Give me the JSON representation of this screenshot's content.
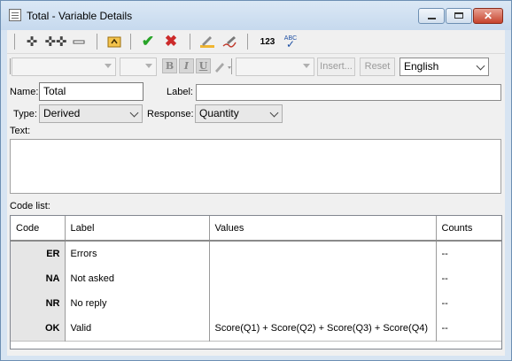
{
  "window": {
    "title": "Total - Variable Details"
  },
  "toolbar2": {
    "insert_label": "Insert...",
    "reset_label": "Reset",
    "language": "English",
    "bold_glyph": "B",
    "italic_glyph": "I",
    "underline_glyph": "U"
  },
  "toolbar1": {
    "number_glyph": "123",
    "spell_glyph": "ABC"
  },
  "form": {
    "name_label": "Name:",
    "name_value": "Total",
    "label_label": "Label:",
    "label_value": "",
    "type_label": "Type:",
    "type_value": "Derived",
    "response_label": "Response:",
    "response_value": "Quantity",
    "text_label": "Text:",
    "codelist_label": "Code list:"
  },
  "codelist": {
    "headers": [
      "Code",
      "Label",
      "Values",
      "Counts"
    ],
    "rows": [
      {
        "code": "ER",
        "label": "Errors",
        "values": "",
        "counts": "--"
      },
      {
        "code": "NA",
        "label": "Not asked",
        "values": "",
        "counts": "--"
      },
      {
        "code": "NR",
        "label": "No reply",
        "values": "",
        "counts": "--"
      },
      {
        "code": "OK",
        "label": "Valid",
        "values": "Score(Q1) + Score(Q2) + Score(Q3) + Score(Q4)",
        "counts": "--"
      }
    ]
  }
}
